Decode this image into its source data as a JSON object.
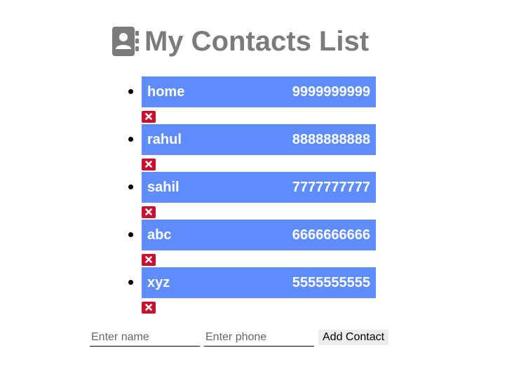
{
  "header": {
    "title": "My Contacts List",
    "icon": "contact-book-icon",
    "title_color": "#7b7b7b"
  },
  "contacts": [
    {
      "name": "home",
      "phone": "9999999999"
    },
    {
      "name": "rahul",
      "phone": "8888888888"
    },
    {
      "name": "sahil",
      "phone": "7777777777"
    },
    {
      "name": "abc",
      "phone": "6666666666"
    },
    {
      "name": "xyz",
      "phone": "5555555555"
    }
  ],
  "delete_icon": "close-icon",
  "form": {
    "name_placeholder": "Enter name",
    "phone_placeholder": "Enter phone",
    "add_label": "Add Contact"
  },
  "colors": {
    "card": "#5f8cff",
    "delete": "#c8102e"
  }
}
